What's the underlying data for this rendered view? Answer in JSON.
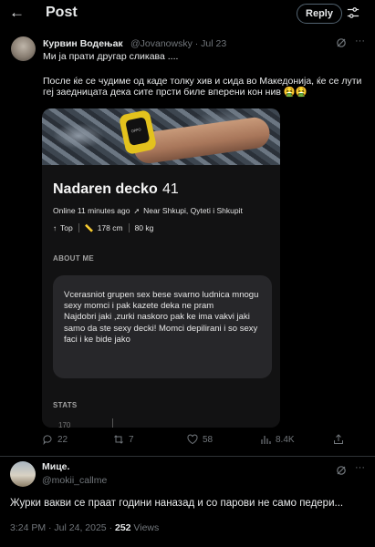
{
  "header": {
    "back_icon": "arrow-left-icon",
    "title": "Post",
    "reply_label": "Reply",
    "settings_icon": "sliders-icon"
  },
  "tweet": {
    "author_name": "Курвин Водењак",
    "author_handle": "@Jovanowsky · Jul 23",
    "line1": "Ми ја прати другар сликава ....",
    "line2": "После ќе се чудиме од каде толку хив и сида во Македонија, ќе се лути геј заедницата дека сите прсти биле вперени кон нив 🤮🤮",
    "embedded": {
      "profile_name": "Nadaren decko",
      "profile_age": "41",
      "online": "Online 11 minutes ago",
      "location": "Near Shkupi, Qyteti i Shkupit",
      "role": "Top",
      "height": "178 cm",
      "weight": "80 kg",
      "about_label": "ABOUT ME",
      "bio": "Vcerasniot grupen sex bese svarno ludnica mnogu sexy momci i pak kazete deka ne pram\nNajdobri jaki ,zurki naskoro pak ke ima vakvi jaki  samo da ste sexy decki! Momci depilirani i so sexy faci i ke bide jako",
      "stats_label": "STATS",
      "bottom_left": "170",
      "bottom_right": "00"
    },
    "actions": {
      "replies": "22",
      "reposts": "7",
      "likes": "58",
      "views": "8.4K"
    }
  },
  "reply": {
    "author_name": "Мице.",
    "author_handle": "@mokii_callme",
    "text": "Журки вакви се праат години наназад и со парови не само педери...",
    "time": "3:24 PM · Jul 24, 2025 · ",
    "views_count": "252",
    "views_label": " Views"
  }
}
